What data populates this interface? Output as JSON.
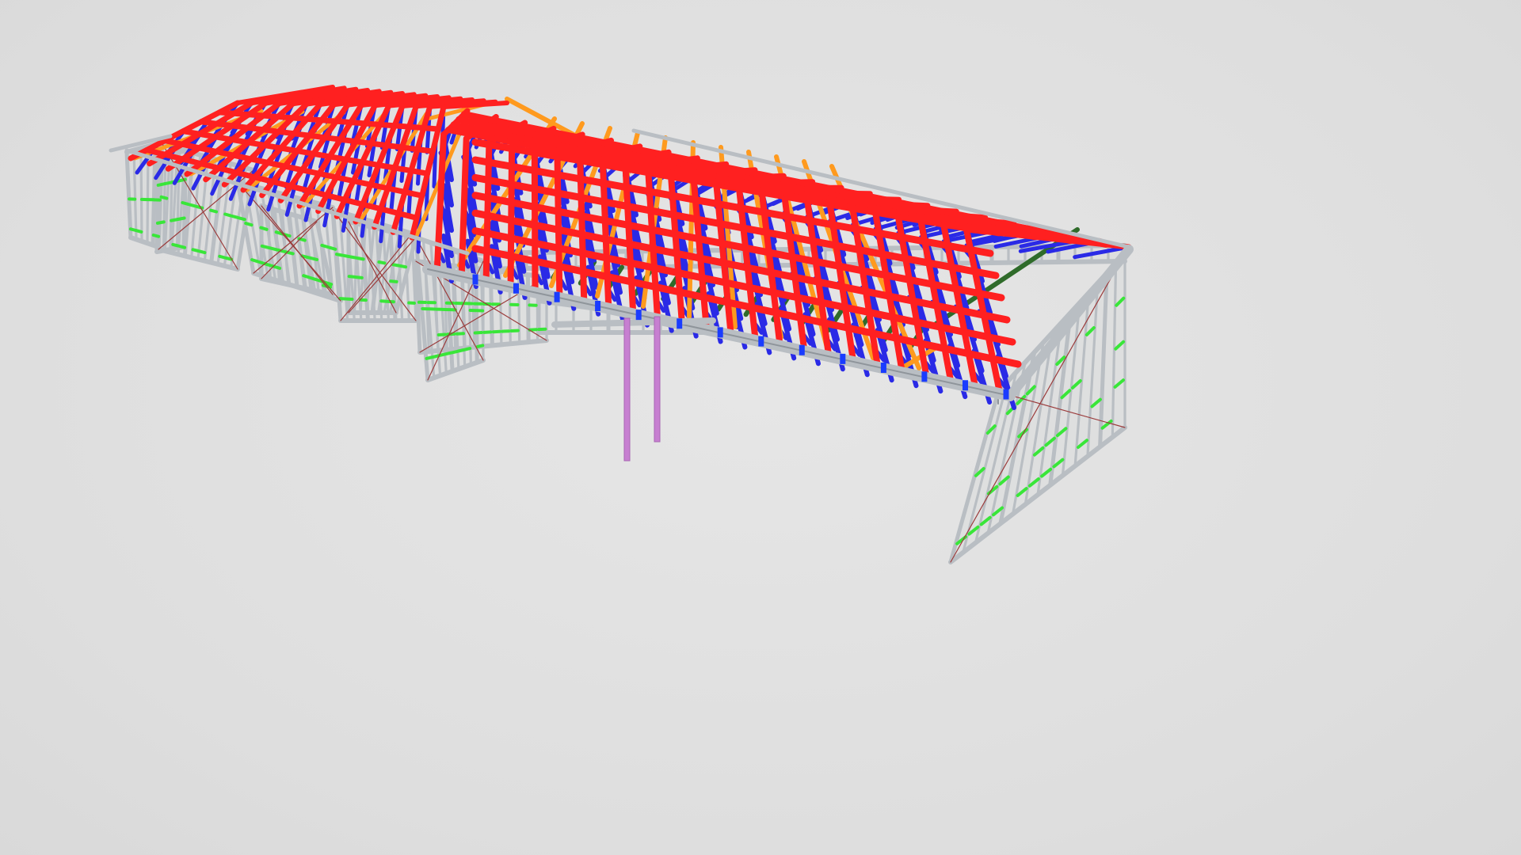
{
  "viewport": {
    "background": "#e1e1e1"
  },
  "model": {
    "subject": "steel-frame-house-with-roof-trusses",
    "colors": {
      "wall_frame": "#b9bec3",
      "wall_frame_edge": "#8f959b",
      "nogging": "#39e639",
      "bracing": "#9b3b3b",
      "truss_chord": "#ff2020",
      "truss_web": "#2a2ae6",
      "hip_rafter": "#ff9a1e",
      "girder": "#2f6b2a",
      "connector": "#1a3cff",
      "post": "#c77fd1"
    }
  }
}
